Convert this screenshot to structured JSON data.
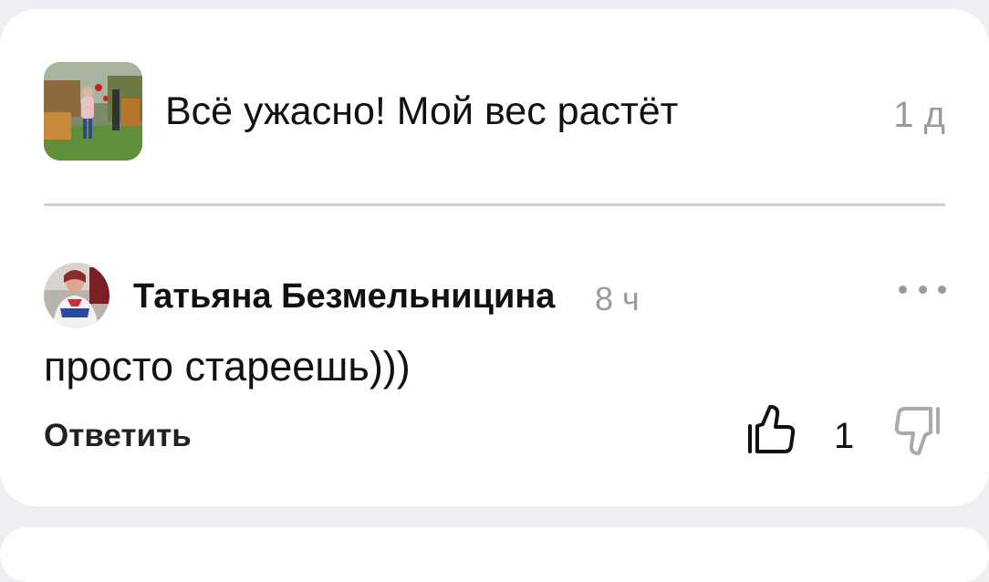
{
  "post": {
    "title": "Всё ужасно! Мой вес растёт",
    "time": "1 д",
    "thumbnail_icon": "photo-thumbnail"
  },
  "comment": {
    "author": "Татьяна Безмельницина",
    "time": "8 ч",
    "text": "просто стареешь)))",
    "reply_label": "Ответить",
    "like_count": "1",
    "more_icon": "more-horizontal-icon",
    "like_icon": "thumbs-up-icon",
    "dislike_icon": "thumbs-down-icon"
  },
  "colors": {
    "background": "#eeeff2",
    "card": "#ffffff",
    "muted_text": "#9a9a9a",
    "divider": "#cfcfd2"
  }
}
